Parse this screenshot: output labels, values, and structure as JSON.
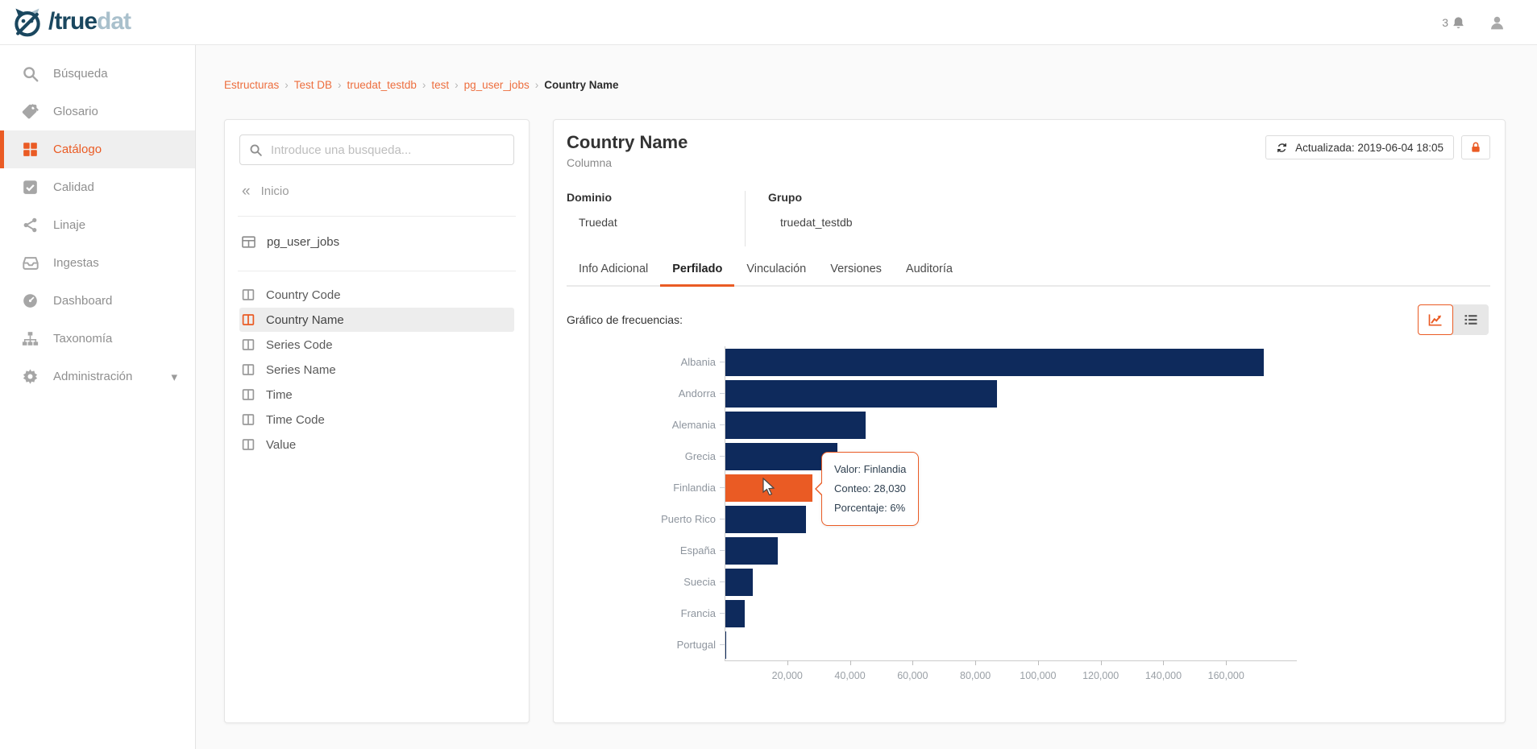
{
  "header": {
    "logo_dark_text": "/true",
    "logo_light_text": "dat",
    "notification_count": "3"
  },
  "sidebar": {
    "items": [
      {
        "label": "Búsqueda",
        "icon": "search",
        "active": false
      },
      {
        "label": "Glosario",
        "icon": "tags",
        "active": false
      },
      {
        "label": "Catálogo",
        "icon": "grid",
        "active": true
      },
      {
        "label": "Calidad",
        "icon": "check-square",
        "active": false
      },
      {
        "label": "Linaje",
        "icon": "share",
        "active": false
      },
      {
        "label": "Ingestas",
        "icon": "inbox",
        "active": false
      },
      {
        "label": "Dashboard",
        "icon": "gauge",
        "active": false
      },
      {
        "label": "Taxonomía",
        "icon": "sitemap",
        "active": false
      },
      {
        "label": "Administración",
        "icon": "gear",
        "active": false,
        "has_caret": true
      }
    ]
  },
  "breadcrumb": {
    "links": [
      "Estructuras",
      "Test DB",
      "truedat_testdb",
      "test",
      "pg_user_jobs"
    ],
    "current": "Country Name",
    "separator": "›"
  },
  "tree_panel": {
    "search_placeholder": "Introduce una busqueda...",
    "back_label": "Inicio",
    "table_name": "pg_user_jobs",
    "columns": [
      {
        "label": "Country Code",
        "selected": false
      },
      {
        "label": "Country Name",
        "selected": true
      },
      {
        "label": "Series Code",
        "selected": false
      },
      {
        "label": "Series Name",
        "selected": false
      },
      {
        "label": "Time",
        "selected": false
      },
      {
        "label": "Time Code",
        "selected": false
      },
      {
        "label": "Value",
        "selected": false
      }
    ]
  },
  "main": {
    "title": "Country Name",
    "subtitle": "Columna",
    "updated_button": "Actualizada: 2019-06-04 18:05",
    "meta": [
      {
        "label": "Dominio",
        "value": "Truedat"
      },
      {
        "label": "Grupo",
        "value": "truedat_testdb"
      }
    ],
    "tabs": [
      {
        "label": "Info Adicional",
        "active": false
      },
      {
        "label": "Perfilado",
        "active": true
      },
      {
        "label": "Vinculación",
        "active": false
      },
      {
        "label": "Versiones",
        "active": false
      },
      {
        "label": "Auditoría",
        "active": false
      }
    ],
    "section_label": "Gráfico de frecuencias:"
  },
  "tooltip": {
    "line1": "Valor: Finlandia",
    "line2": "Conteo: 28,030",
    "line3": "Porcentaje: 6%"
  },
  "colors": {
    "accent": "#EA5B24",
    "bar": "#0E2A5C"
  },
  "chart_data": {
    "type": "bar",
    "orientation": "horizontal",
    "title": "Gráfico de frecuencias",
    "categories": [
      "Albania",
      "Andorra",
      "Alemania",
      "Grecia",
      "Finlandia",
      "Puerto Rico",
      "España",
      "Suecia",
      "Francia",
      "Portugal"
    ],
    "values": [
      172000,
      87000,
      45000,
      36000,
      28030,
      26000,
      17000,
      9000,
      6500,
      600
    ],
    "highlighted_category": "Finlandia",
    "highlighted_value": 28030,
    "highlighted_percentage": "6%",
    "xticks": [
      20000,
      40000,
      60000,
      80000,
      100000,
      120000,
      140000,
      160000
    ],
    "xtick_labels": [
      "20,000",
      "40,000",
      "60,000",
      "80,000",
      "100,000",
      "120,000",
      "140,000",
      "160,000"
    ],
    "xlim": [
      0,
      180000
    ],
    "bar_color": "#0E2A5C",
    "highlight_color": "#EA5B24",
    "grid": false,
    "legend": false
  }
}
